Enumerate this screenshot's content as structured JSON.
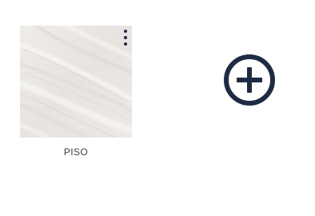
{
  "items": [
    {
      "label": "PISO",
      "thumbnail": "marble-texture-image",
      "menu_icon": "kebab-menu-icon"
    }
  ],
  "add_button": {
    "icon": "plus-circle-icon"
  },
  "colors": {
    "icon_navy": "#1f2a44",
    "label_text": "#3b3f4a",
    "marble_base": "#ebe8e6"
  }
}
